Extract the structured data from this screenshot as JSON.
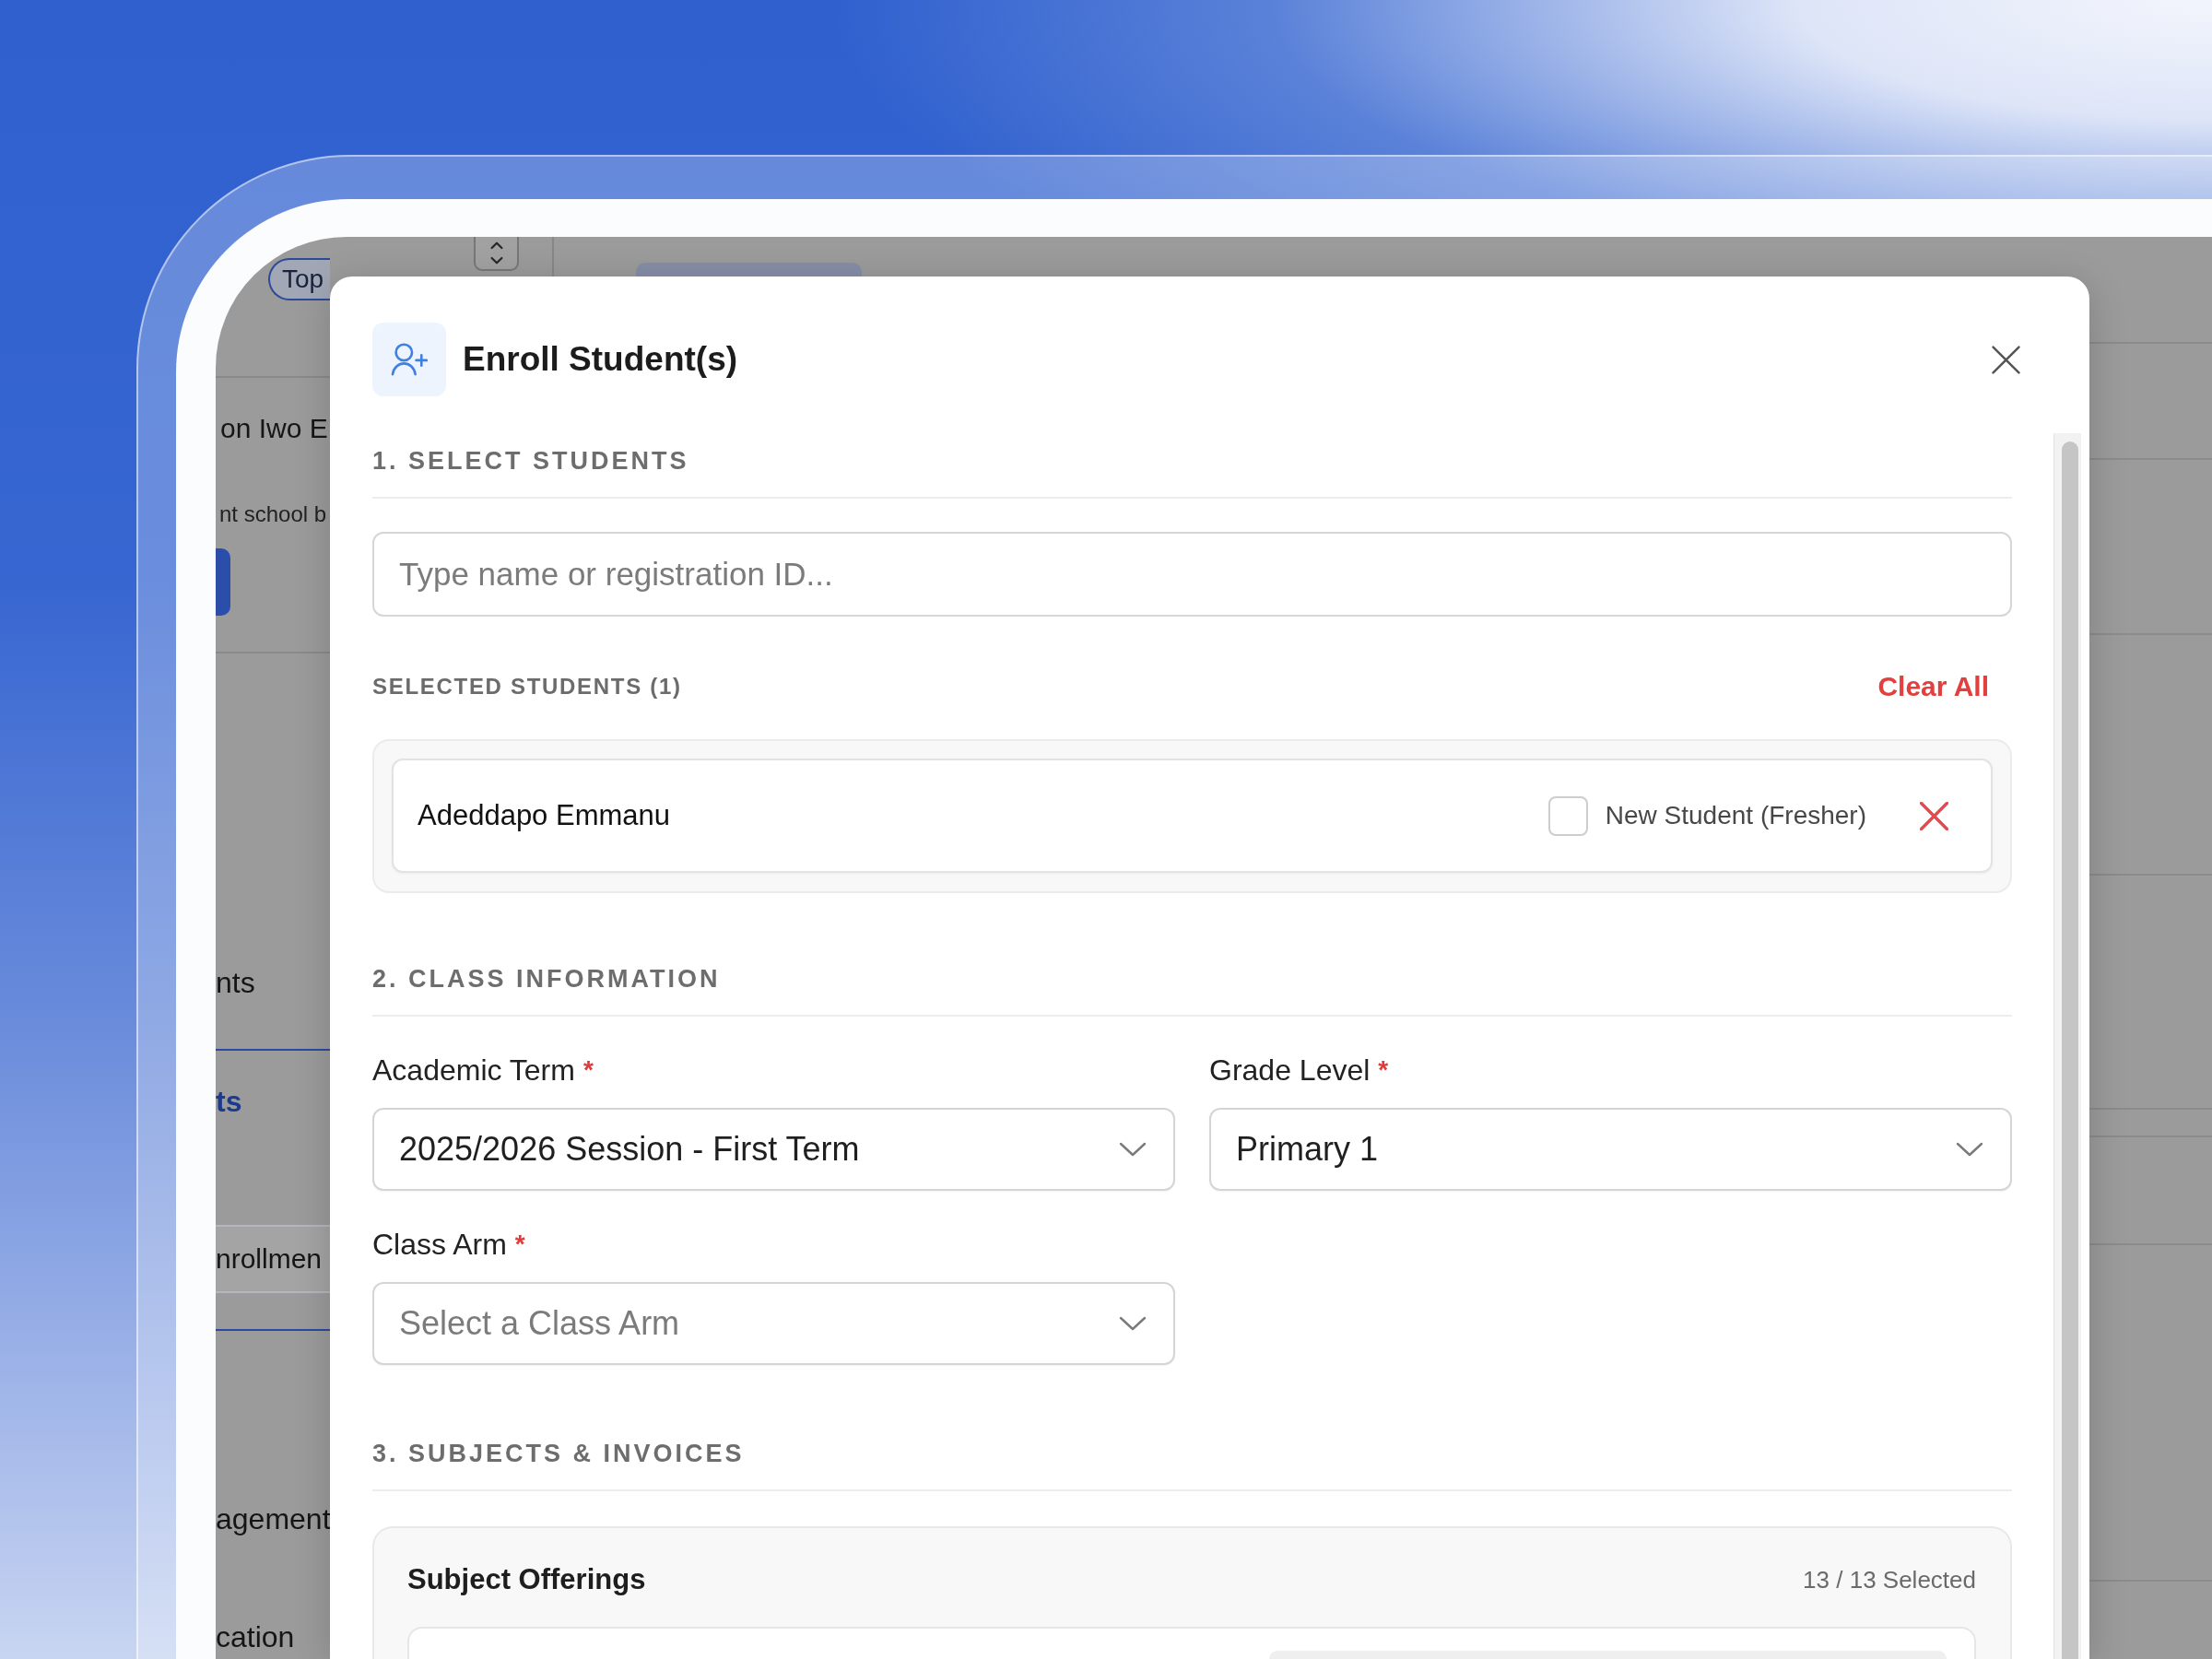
{
  "background_app": {
    "sidebar": {
      "filter_chip": "Top",
      "school_name": "on Iwo E",
      "school_subtitle": "nt school b",
      "nav_items": [
        {
          "label": "nts",
          "selected": false
        },
        {
          "label": "ts",
          "selected": true,
          "children": [
            {
              "label": "nrollmen",
              "selected": true
            }
          ]
        },
        {
          "label": "agement",
          "selected": false
        },
        {
          "label": "cation",
          "selected": false
        }
      ]
    }
  },
  "modal": {
    "title": "Enroll Student(s)",
    "sections": [
      {
        "kind": "students",
        "title": "1. SELECT STUDENTS",
        "search": {
          "placeholder": "Type name or registration ID..."
        },
        "selected_heading": "SELECTED STUDENTS (1)",
        "clear_action": "Clear All",
        "students": [
          {
            "name": "Adeddapo Emmanu",
            "fresher_label": "New Student (Fresher)",
            "checked": false
          }
        ]
      },
      {
        "kind": "class",
        "title": "2. CLASS INFORMATION",
        "fields": [
          {
            "label": "Academic Term",
            "required_mark": "*",
            "value": "2025/2026 Session - First Term"
          },
          {
            "label": "Grade Level",
            "required_mark": "*",
            "value": "Primary 1"
          },
          {
            "label": "Class Arm",
            "required_mark": "*",
            "placeholder": "Select a Class Arm"
          }
        ]
      },
      {
        "kind": "subjects",
        "title": "3. SUBJECTS & INVOICES",
        "offerings": {
          "title": "Subject Offerings",
          "count": "13 / 13 Selected"
        }
      }
    ]
  }
}
